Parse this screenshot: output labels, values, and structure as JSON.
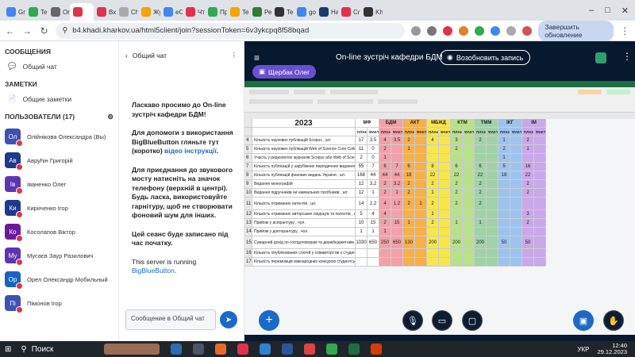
{
  "browser": {
    "tabs": [
      {
        "label": "Gm",
        "color": "#4285f4"
      },
      {
        "label": "Te",
        "color": "#34a853"
      },
      {
        "label": "Or",
        "color": "#666"
      },
      {
        "label": "",
        "color": "#e0334b",
        "active": true
      },
      {
        "label": "Вх",
        "color": "#e0334b"
      },
      {
        "label": "Ch",
        "color": "#aaa"
      },
      {
        "label": "Жу",
        "color": "#f4a300"
      },
      {
        "label": "eC",
        "color": "#4285f4"
      },
      {
        "label": "Чт",
        "color": "#e0334b"
      },
      {
        "label": "Пр",
        "color": "#34a853"
      },
      {
        "label": "Te",
        "color": "#f4a300"
      },
      {
        "label": "Ре",
        "color": "#2e7d32"
      },
      {
        "label": "Te",
        "color": "#333"
      },
      {
        "label": "go",
        "color": "#4285f4"
      },
      {
        "label": "На",
        "color": "#1b3a6b"
      },
      {
        "label": "Cr",
        "color": "#e0334b"
      },
      {
        "label": "Kh",
        "color": "#333"
      }
    ],
    "url": "b4.khadi.kharkov.ua/html5client/join?sessionToken=6v3ykcpq8f58bqad",
    "update_label": "Завершить обновление"
  },
  "sidebar": {
    "messages_title": "СООБЩЕНИЯ",
    "public_chat": "Общий чат",
    "notes_title": "ЗАМЕТКИ",
    "shared_notes": "Общие заметки",
    "users_title": "ПОЛЬЗОВАТЕЛИ (17)",
    "users": [
      {
        "initials": "Ол",
        "name": "Олійнікова Олександра (Вы)",
        "color": "#3f51b5"
      },
      {
        "initials": "Ав",
        "name": "Авруһін Григорій",
        "color": "#1e3a8a"
      },
      {
        "initials": "Ів",
        "name": "Іваненко Олег",
        "color": "#5e35b1"
      },
      {
        "initials": "Ки",
        "name": "Кириченко Ігор",
        "color": "#1e3a8a"
      },
      {
        "initials": "Ко",
        "name": "Косолапов Віктор",
        "color": "#6a1b9a"
      },
      {
        "initials": "Му",
        "name": "Мусаєв Заур Разилович",
        "color": "#5e35b1"
      },
      {
        "initials": "Ор",
        "name": "Орел Олександр Мобильный",
        "color": "#1565c0"
      },
      {
        "initials": "Пі",
        "name": "Пімонов Ігор",
        "color": "#3f51b5"
      }
    ]
  },
  "chat": {
    "title": "Общий чат",
    "msg1": "Ласкаво просимо до On-line зустріч кафедри БДМ!",
    "msg2_a": "Для допомоги з використання BigBlueButton гляньте тут (коротко) ",
    "msg2_link": "відео інструкції",
    "msg2_b": ".",
    "msg3": "Для приєднання до звукового мосту натисніть на значок телефону (верхній в центрі). Будь ласка, використовуйте гарнітуру, щоб не створювати фоновий шум для інших.",
    "msg4": "Цей сеанс буде записано під час початку.",
    "msg5_a": "This server is running ",
    "msg5_link": "BigBlueButton",
    "msg5_b": ".",
    "input_placeholder": "Сообщение в Общий чат"
  },
  "meeting": {
    "title": "On-line зустріч кафедри БДМ",
    "record_label": "Возобновить запись",
    "presenter": "Щербак Олег"
  },
  "spreadsheet": {
    "year": "2023",
    "groups": [
      "МФ",
      "БДМ",
      "АКТ",
      "МБЖД",
      "КТМ",
      "ТММ",
      "ІКГ",
      "ІМ"
    ],
    "rows": [
      {
        "n": "4",
        "label": "Кількість наукових публікацій Scopus , шт.",
        "v": [
          "17",
          "3.5",
          "4",
          "3.5",
          "2",
          "",
          "4",
          "",
          "3",
          "",
          "2",
          "",
          "1",
          "",
          "2",
          ""
        ]
      },
      {
        "n": "5",
        "label": "Кількість наукових публікацій Web of Science Core Collection , шт.",
        "v": [
          "11",
          "0",
          "2",
          "",
          "1",
          "",
          "",
          "",
          "2",
          "",
          "",
          "",
          "2",
          "",
          "1",
          ""
        ]
      },
      {
        "n": "6",
        "label": "Участь у редколегіях журналів Scopus або Web of Science Core Collection, чол.",
        "v": [
          "2",
          "0",
          "1",
          "",
          "",
          "",
          "",
          "",
          "",
          "",
          "",
          "",
          "1",
          "",
          "",
          ""
        ]
      },
      {
        "n": "7",
        "label": "Кількість публікацій у зарубіжних періодичних виданнях , шт.",
        "v": [
          "55",
          "7",
          "8",
          "7",
          "6",
          "",
          "8",
          "",
          "6",
          "",
          "6",
          "",
          "5",
          "",
          "16",
          ""
        ]
      },
      {
        "n": "8",
        "label": "Кількість публікацій фахових видань України , шт.",
        "v": [
          "168",
          "44",
          "44",
          "44",
          "18",
          "",
          "22",
          "",
          "22",
          "",
          "22",
          "",
          "18",
          "",
          "22",
          ""
        ]
      },
      {
        "n": "9",
        "label": "Видання монографій",
        "v": [
          "12",
          "3.2",
          "2",
          "3.2",
          "2",
          "",
          "2",
          "",
          "2",
          "",
          "2",
          "",
          "",
          "",
          "2",
          ""
        ]
      },
      {
        "n": "10",
        "label": "Видання підручників чи навчальних посібників , шт.",
        "v": [
          "12",
          "1",
          "2",
          "1",
          "2",
          "",
          "1",
          "",
          "2",
          "",
          "2",
          "",
          "",
          "",
          "2",
          ""
        ]
      },
      {
        "n": "11",
        "label": "Кількість отриманих патентів , шт.",
        "v": [
          "14",
          "2.2",
          "4",
          "1.2",
          "2",
          "1",
          "2",
          "",
          "2",
          "",
          "2",
          "",
          "",
          "",
          "",
          ""
        ]
      },
      {
        "n": "12",
        "label": "Кількість отриманих авторських свідоцтв та патентів , шт.",
        "v": [
          "5",
          "4",
          "4",
          "",
          "",
          "",
          "1",
          "",
          "",
          "",
          "",
          "",
          "",
          "",
          "3",
          ""
        ]
      },
      {
        "n": "13",
        "label": "Прийом у аспірантуру , чол.",
        "v": [
          "10",
          "15",
          "2",
          "15",
          "1",
          "",
          "2",
          "",
          "1",
          "",
          "1",
          "",
          "",
          "",
          "2",
          ""
        ]
      },
      {
        "n": "14",
        "label": "Прийом у докторантуру , чол.",
        "v": [
          "1",
          "1",
          "1",
          "",
          "",
          "",
          "",
          "",
          "",
          "",
          "",
          "",
          "",
          "",
          "",
          ""
        ]
      },
      {
        "n": "15",
        "label": "Сумарний дохід по госпдоговорам та держбюджетним темам, тис. грн.",
        "v": [
          "1030",
          "650",
          "250",
          "650",
          "130",
          "",
          "200",
          "",
          "200",
          "",
          "200",
          "",
          "50",
          "",
          "50",
          ""
        ]
      },
      {
        "n": "16",
        "label": "Кількість опублікованих статей у співавторстві з студентами",
        "v": [
          "",
          "",
          "",
          "",
          "",
          "",
          "",
          "",
          "",
          "",
          "",
          "",
          "",
          "",
          "",
          ""
        ]
      },
      {
        "n": "17",
        "label": "Кількість переможців міжнародних конкурсів студентських НДР",
        "v": [
          "",
          "",
          "",
          "",
          "",
          "",
          "",
          "",
          "",
          "",
          "",
          "",
          "",
          "",
          "",
          ""
        ]
      }
    ],
    "plan_label": "ПЛАН",
    "fact_label": "ФАКТ"
  },
  "taskbar": {
    "search_label": "Поиск",
    "lang": "УКР",
    "time": "12:40",
    "date": "29.12.2023"
  },
  "colors": {
    "bdm": "#f2a0a8",
    "akt": "#f5b04a",
    "mbzhd": "#f7e64a",
    "ktm": "#b7e08a",
    "tmm": "#9fd3a6",
    "ikg": "#9cc3ee",
    "im": "#c8a8e8"
  }
}
